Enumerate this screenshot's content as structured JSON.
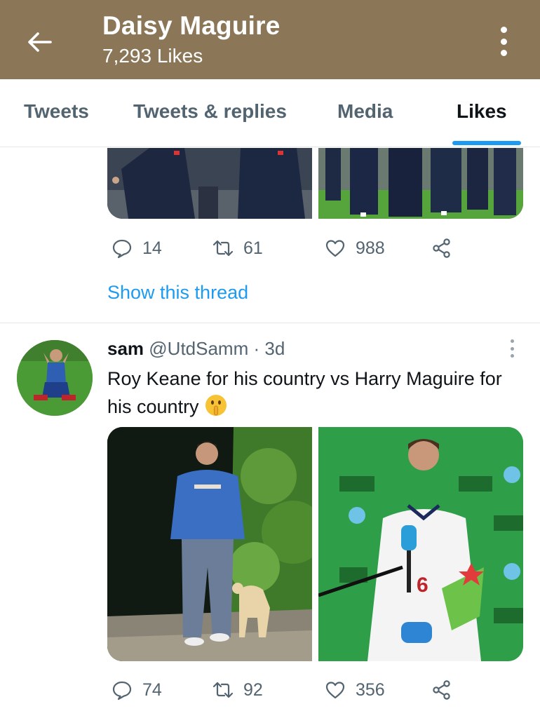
{
  "header": {
    "title": "Daisy Maguire",
    "subtitle": "7,293 Likes",
    "background": "#8b7758"
  },
  "tabs": [
    {
      "label": "Tweets",
      "active": false
    },
    {
      "label": "Tweets & replies",
      "active": false
    },
    {
      "label": "Media",
      "active": false
    },
    {
      "label": "Likes",
      "active": true
    }
  ],
  "accent_color": "#1d9bf0",
  "tweets": [
    {
      "media": [
        "photo-of-manager-in-training-jacket",
        "photo-of-england-players-at-training"
      ],
      "stats": {
        "replies": "14",
        "retweets": "61",
        "likes": "988"
      },
      "show_thread": "Show this thread"
    },
    {
      "author_name": "sam",
      "author_handle": "@UtdSamm",
      "separator": "·",
      "time": "3d",
      "text": "Roy Keane for his country vs Harry Maguire for his country",
      "emoji": "shushing-face",
      "media": [
        "photo-of-roy-keane-walking-dog",
        "photo-of-harry-maguire-star-of-the-match"
      ],
      "stats": {
        "replies": "74",
        "retweets": "92",
        "likes": "356"
      }
    }
  ],
  "icons": {
    "back": "arrow-left-icon",
    "more": "more-vertical-icon",
    "reply": "reply-icon",
    "retweet": "retweet-icon",
    "like": "heart-icon",
    "share": "share-icon"
  }
}
